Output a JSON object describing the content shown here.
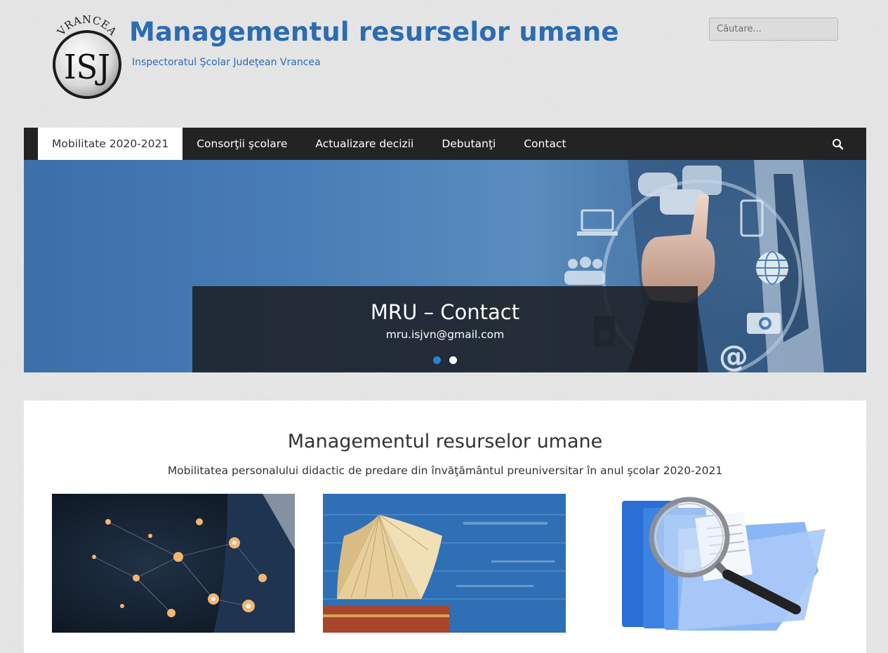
{
  "header": {
    "logo": {
      "arc_text": "VRANCEA",
      "monogram": "ISJ",
      "icon": "isj-seal-logo"
    },
    "title": "Managementul resurselor umane",
    "description": "Inspectoratul Şcolar Judeţean Vrancea",
    "search": {
      "placeholder": "Căutare...",
      "value": ""
    }
  },
  "nav": {
    "items": [
      {
        "label": "Mobilitate 2020-2021",
        "active": true
      },
      {
        "label": "Consorţii şcolare",
        "active": false
      },
      {
        "label": "Actualizare decizii",
        "active": false
      },
      {
        "label": "Debutanţi",
        "active": false
      },
      {
        "label": "Contact",
        "active": false
      }
    ],
    "search_icon": "search-icon"
  },
  "slider": {
    "caption_title": "MRU – Contact",
    "caption_text": "mru.isjvn@gmail.com",
    "slides_count": 2,
    "active_slide": 1,
    "image_icons": [
      "chat-bubbles-icon",
      "laptop-icon",
      "smartphone-icon",
      "people-icon",
      "globe-icon",
      "camera-icon",
      "at-sign-icon",
      "shopping-cart-icon",
      "speaker-icon"
    ]
  },
  "main": {
    "title": "Managementul resurselor umane",
    "subtitle": "Mobilitatea personalului didactic de predare din învăţământul preuniversitar în anul şcolar 2020-2021",
    "thumbnails": [
      {
        "name": "network-people-image"
      },
      {
        "name": "open-book-image"
      },
      {
        "name": "folders-magnifier-image"
      }
    ]
  },
  "colors": {
    "brand_blue": "#2b6cb3",
    "nav_background": "#232323",
    "slider_blue": "#4a7eb6",
    "dot_active": "#2b7fd6",
    "dot_inactive": "#ffffff"
  }
}
